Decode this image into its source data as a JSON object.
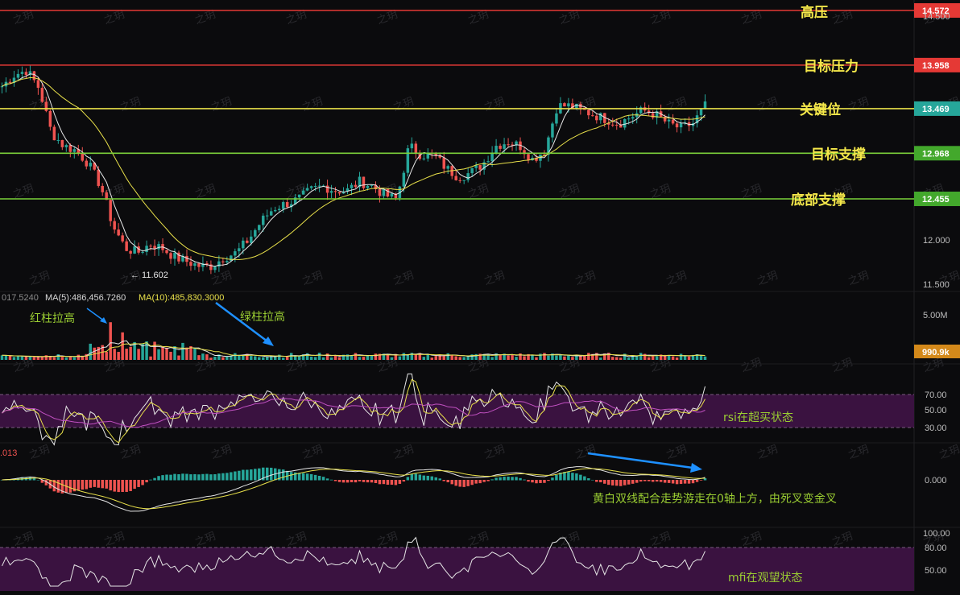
{
  "chart_data": [
    {
      "type": "candlestick",
      "name": "price",
      "y_ticks": [
        "12.000",
        "11.500"
      ],
      "top_tick": "14.500",
      "levels": [
        {
          "label": "高压",
          "value": 14.572,
          "tag": "14.572",
          "color": "#e53935"
        },
        {
          "label": "目标压力",
          "value": 13.958,
          "tag": "13.958",
          "color": "#e53935"
        },
        {
          "label": "关键位",
          "value": 13.469,
          "tag": "13.469",
          "color": "#e8e04a"
        },
        {
          "label": "目标支撑",
          "value": 12.968,
          "tag": "12.968",
          "color": "#7bd13a"
        },
        {
          "label": "底部支撑",
          "value": 12.455,
          "tag": "12.455",
          "color": "#7bd13a"
        }
      ],
      "min_marker": "← 11.602",
      "close_approx": [
        13.72,
        13.85,
        13.9,
        13.7,
        13.2,
        13.05,
        13.0,
        12.85,
        12.6,
        12.15,
        11.9,
        11.85,
        11.95,
        11.9,
        11.8,
        11.75,
        11.7,
        11.7,
        11.8,
        11.85,
        12.0,
        12.2,
        12.35,
        12.4,
        12.45,
        12.55,
        12.6,
        12.55,
        12.55,
        12.65,
        12.6,
        12.5,
        12.45,
        13.05,
        12.95,
        12.95,
        12.8,
        12.7,
        12.75,
        12.85,
        13.05,
        13.1,
        13.05,
        12.9,
        13.0,
        13.5,
        13.5,
        13.45,
        13.4,
        13.35,
        13.3,
        13.38,
        13.45,
        13.4,
        13.3,
        13.25,
        13.3,
        13.5
      ]
    },
    {
      "type": "bar",
      "name": "volume",
      "partial_tick": "017.5240",
      "ma5": "MA(5):486,456.7260",
      "ma10": "MA(10):485,830.3000",
      "y_tick": "5.00M",
      "last_tag": "990.9k",
      "annotations": [
        "红柱拉高",
        "绿柱拉高"
      ]
    },
    {
      "type": "line",
      "name": "rsi",
      "y_ticks": [
        "70.00",
        "50.00",
        "30.00"
      ],
      "annotation": "rsi在超买状态"
    },
    {
      "type": "line",
      "name": "macd",
      "partial_tick": ".013",
      "y_tick": "0.000",
      "annotation": "黄白双线配合走势游走在0轴上方，由死叉变金叉"
    },
    {
      "type": "line",
      "name": "mfi",
      "y_ticks": [
        "100.00",
        "80.00",
        "50.00"
      ],
      "annotation": "mfi在观望状态"
    }
  ],
  "watermark": "之玥",
  "colors": {
    "up": "#26a69a",
    "down": "#ef5350",
    "ma_white": "#e6e6e6",
    "ma_yellow": "#e8e04a",
    "band": "#3a1240",
    "arrow": "#1e90ff",
    "annotation_green": "#9acd32",
    "level_text": "#f5e84a"
  }
}
